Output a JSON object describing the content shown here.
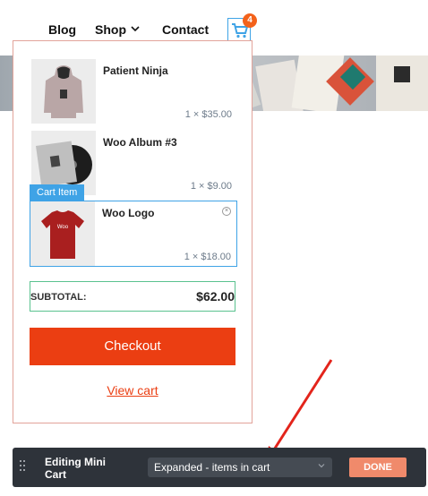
{
  "nav": {
    "blog": "Blog",
    "shop": "Shop",
    "contact": "Contact",
    "cart_count": "4"
  },
  "mini_cart": {
    "items": [
      {
        "name": "Patient Ninja",
        "price": "1 × $35.00"
      },
      {
        "name": "Woo Album #3",
        "price": "1 × $9.00"
      },
      {
        "name": "Woo Logo",
        "price": "1 × $18.00"
      }
    ],
    "cart_item_tag": "Cart Item",
    "subtotal_label": "SUBTOTAL:",
    "subtotal_value": "$62.00",
    "checkout_label": "Checkout",
    "view_cart_label": "View cart"
  },
  "editor": {
    "title": "Editing Mini Cart",
    "select_value": "Expanded - items in cart",
    "done_label": "DONE"
  },
  "colors": {
    "accent": "#eb3e12",
    "badge": "#f3621b",
    "selection_blue": "#3fa3e6",
    "subtotal_green": "#5ac28f",
    "editor_bg": "#2e333a"
  }
}
